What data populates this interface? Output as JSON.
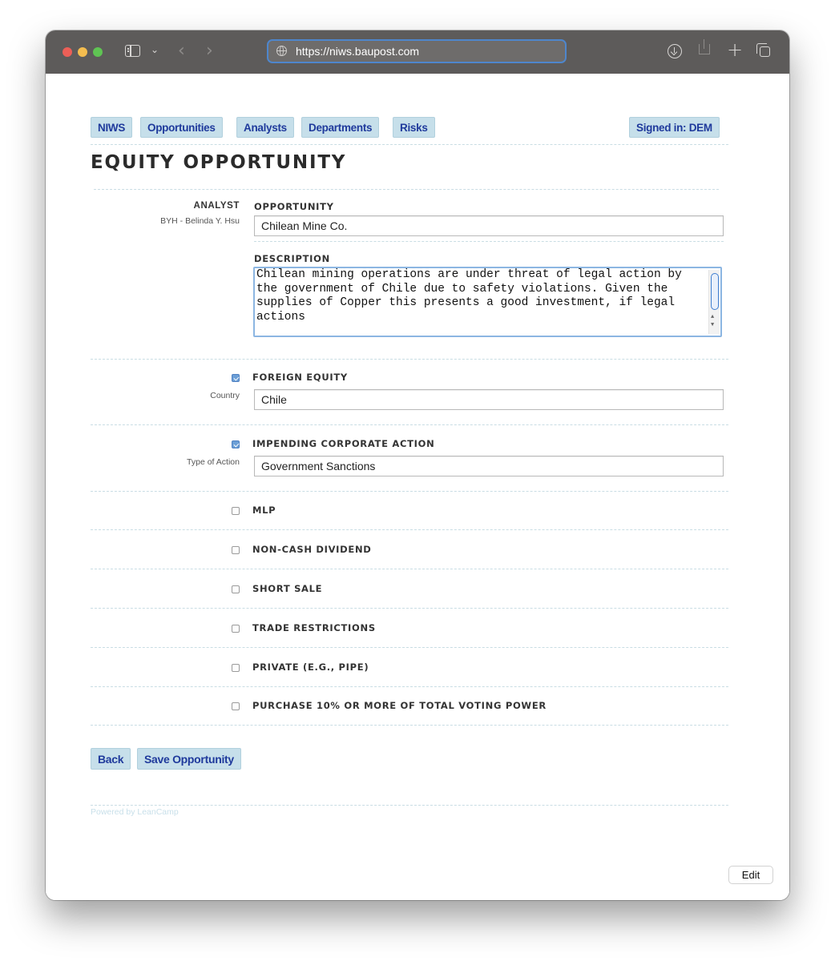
{
  "browser": {
    "url": "https://niws.baupost.com"
  },
  "nav": {
    "items": [
      "NIWS",
      "Opportunities",
      "Analysts",
      "Departments",
      "Risks"
    ],
    "signed_in": "Signed in: DEM"
  },
  "page_title": "EQUITY OPPORTUNITY",
  "analyst": {
    "label": "ANALYST",
    "value": "BYH - Belinda Y. Hsu"
  },
  "opportunity": {
    "label": "OPPORTUNITY",
    "value": "Chilean Mine Co."
  },
  "description": {
    "label": "DESCRIPTION",
    "value": "Chilean mining operations are under threat of legal action by the government of Chile due to safety violations. Given the supplies of Copper this presents a good investment, if legal actions"
  },
  "foreign_equity": {
    "label": "FOREIGN EQUITY",
    "checked": true,
    "sub_label": "Country",
    "value": "Chile"
  },
  "corporate_action": {
    "label": "IMPENDING CORPORATE ACTION",
    "checked": true,
    "sub_label": "Type of Action",
    "value": "Government Sanctions"
  },
  "checkboxes": [
    {
      "label": "MLP",
      "checked": false
    },
    {
      "label": "NON-CASH DIVIDEND",
      "checked": false
    },
    {
      "label": "SHORT SALE",
      "checked": false
    },
    {
      "label": "TRADE RESTRICTIONS",
      "checked": false
    },
    {
      "label": "PRIVATE (E.G., PIPE)",
      "checked": false
    },
    {
      "label": "PURCHASE 10% OR MORE OF TOTAL VOTING POWER",
      "checked": false
    }
  ],
  "actions": {
    "back": "Back",
    "save": "Save Opportunity"
  },
  "footer": "Powered by LeanCamp",
  "edit_button": "Edit",
  "colors": {
    "nav_button_bg": "#c6dfea",
    "nav_button_text": "#1f3a9c",
    "titlebar": "#5d5b5a",
    "url_focus": "#4e86cc"
  }
}
